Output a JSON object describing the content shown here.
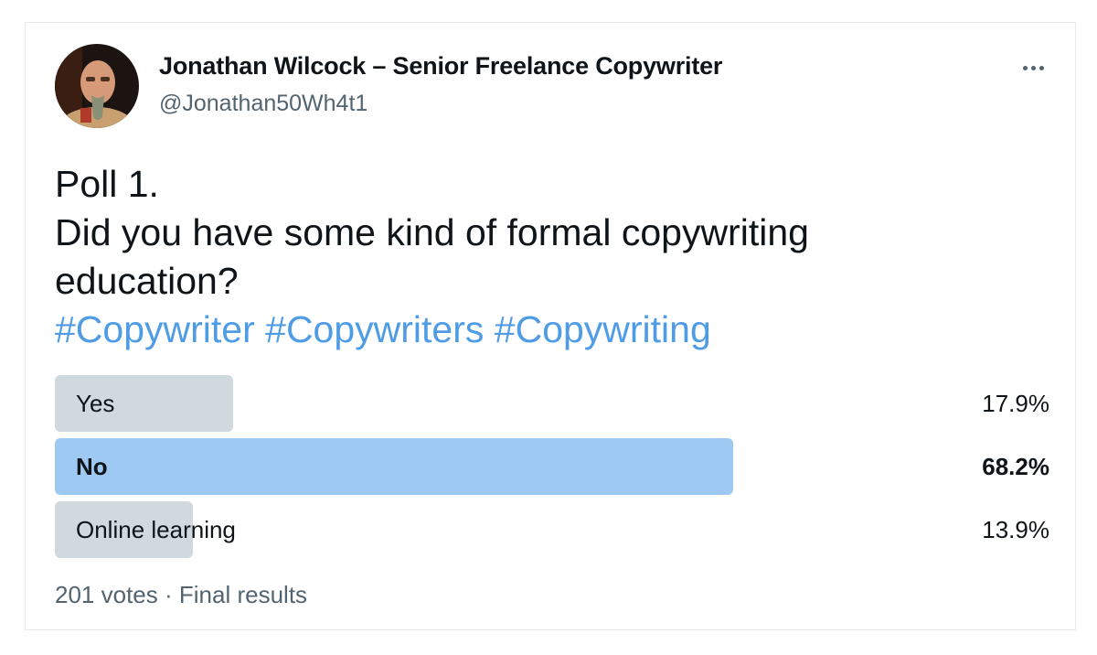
{
  "author": {
    "display_name": "Jonathan Wilcock – Senior Freelance Copywriter",
    "handle": "@Jonathan50Wh4t1"
  },
  "tweet": {
    "lines": [
      "Poll 1.",
      "Did you have some kind of formal copywriting",
      "education?"
    ],
    "hashtags": [
      "#Copywriter",
      "#Copywriters",
      "#Copywriting"
    ]
  },
  "poll": {
    "options": [
      {
        "label": "Yes",
        "percent_text": "17.9%",
        "percent": 17.9,
        "winner": false
      },
      {
        "label": "No",
        "percent_text": "68.2%",
        "percent": 68.2,
        "winner": true
      },
      {
        "label": "Online learning",
        "percent_text": "13.9%",
        "percent": 13.9,
        "winner": false
      }
    ],
    "votes": "201 votes",
    "separator": "·",
    "status": "Final results"
  },
  "icons": {
    "more": "more-horizontal-icon",
    "avatar": "profile-photo"
  },
  "colors": {
    "hashtag": "#4f9ce6",
    "winner_bar": "#9ec9f3",
    "bar": "#cfd9de",
    "secondary_text": "#536471"
  }
}
